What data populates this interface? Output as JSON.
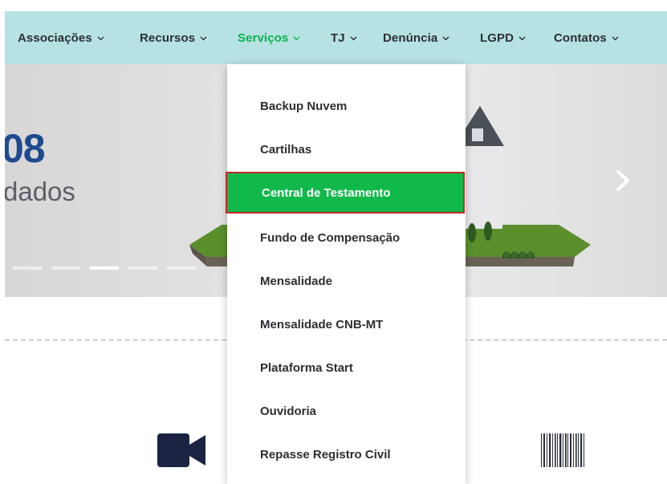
{
  "nav": {
    "items": [
      {
        "label": "Associações",
        "active": false
      },
      {
        "label": "Recursos",
        "active": false
      },
      {
        "label": "Serviços",
        "active": true
      },
      {
        "label": "TJ",
        "active": false
      },
      {
        "label": "Denúncia",
        "active": false
      },
      {
        "label": "LGPD",
        "active": false
      },
      {
        "label": "Contatos",
        "active": false
      }
    ]
  },
  "hero": {
    "number_fragment": "08",
    "subtitle_fragment": "dados",
    "next_icon": "chevron-right-icon",
    "slide_count": 5,
    "active_slide": 3
  },
  "dropdown": {
    "items": [
      {
        "label": "Backup Nuvem"
      },
      {
        "label": "Cartilhas"
      },
      {
        "label": "Central de Testamento",
        "highlighted": true
      },
      {
        "label": "Fundo de Compensação"
      },
      {
        "label": "Mensalidade"
      },
      {
        "label": "Mensalidade CNB-MT"
      },
      {
        "label": "Plataforma Start"
      },
      {
        "label": "Ouvidoria"
      },
      {
        "label": "Repasse Registro Civil"
      }
    ]
  },
  "lower": {
    "icons": [
      "video-camera-icon",
      "barcode-icon"
    ]
  },
  "colors": {
    "navbar_bg": "#b7e2e3",
    "active_nav": "#0ab34f",
    "highlight_bg": "#10b94a",
    "highlight_border": "#c62828",
    "hero_number": "#1e4a8e",
    "icon_dark": "#1a2442"
  }
}
